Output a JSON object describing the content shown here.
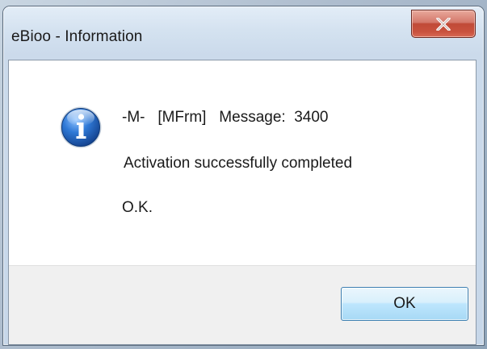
{
  "window": {
    "title": "eBioo - Information",
    "close_icon": "close-icon"
  },
  "message": {
    "icon": "info-icon",
    "line1": "-M-   [MFrm]   Message:  3400",
    "line2": "Activation successfully completed",
    "line3": "O.K."
  },
  "buttons": {
    "ok_label": "OK"
  },
  "colors": {
    "close_red": "#c04a37",
    "ok_blue": "#3c7fb1",
    "info_blue": "#1f5fb8"
  }
}
